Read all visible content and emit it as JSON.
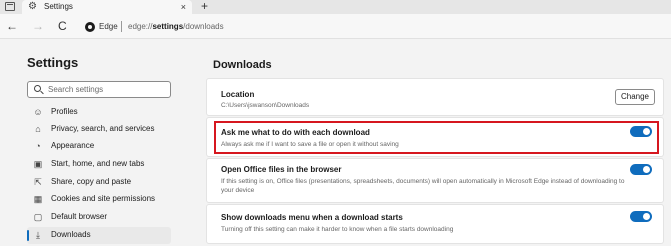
{
  "browser": {
    "tab_title": "Settings",
    "tab_close": "×",
    "new_tab": "+",
    "back": "←",
    "forward": "→",
    "refresh": "C",
    "edge_label": "Edge",
    "url_prefix": "edge://",
    "url_bold": "settings",
    "url_suffix": "/downloads"
  },
  "sidebar": {
    "title": "Settings",
    "search_placeholder": "Search settings",
    "items": [
      {
        "label": "Profiles",
        "icon": "profile-icon",
        "glyph": "☺"
      },
      {
        "label": "Privacy, search, and services",
        "icon": "lock-icon",
        "glyph": "⌂"
      },
      {
        "label": "Appearance",
        "icon": "appearance-icon",
        "glyph": "◔"
      },
      {
        "label": "Start, home, and new tabs",
        "icon": "home-tabs-icon",
        "glyph": "▣"
      },
      {
        "label": "Share, copy and paste",
        "icon": "share-icon",
        "glyph": "⇱"
      },
      {
        "label": "Cookies and site permissions",
        "icon": "cookies-icon",
        "glyph": "▦"
      },
      {
        "label": "Default browser",
        "icon": "browser-icon",
        "glyph": "▢"
      },
      {
        "label": "Downloads",
        "icon": "download-icon",
        "glyph": "⤓",
        "active": true
      }
    ]
  },
  "main": {
    "title": "Downloads",
    "location": {
      "title": "Location",
      "path": "C:\\Users\\jswanson\\Downloads",
      "button": "Change"
    },
    "settings": [
      {
        "title": "Ask me what to do with each download",
        "desc": "Always ask me if I want to save a file or open it without saving",
        "enabled": true
      },
      {
        "title": "Open Office files in the browser",
        "desc": "If this setting is on, Office files (presentations, spreadsheets, documents) will open automatically in Microsoft Edge instead of downloading to your device",
        "enabled": true
      },
      {
        "title": "Show downloads menu when a download starts",
        "desc": "Turning off this setting can make it harder to know when a file starts downloading",
        "enabled": true
      }
    ]
  },
  "colors": {
    "accent": "#0f6cbd",
    "highlight": "#d6171f"
  }
}
